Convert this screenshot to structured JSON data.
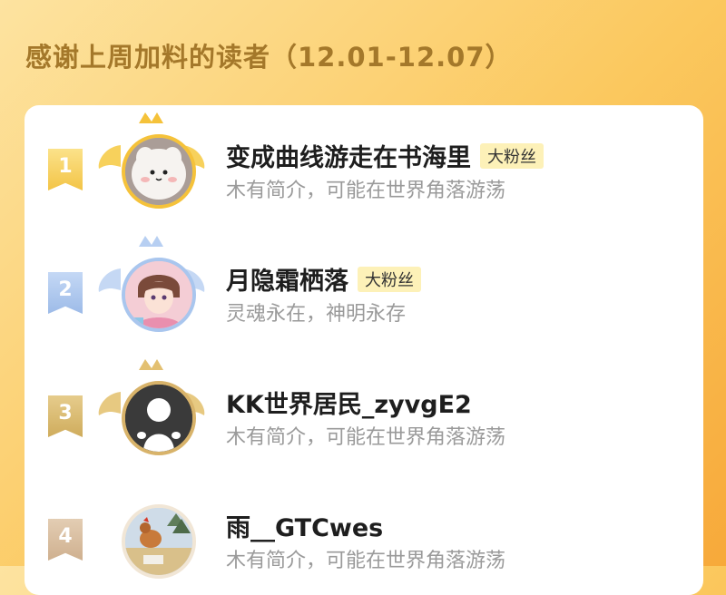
{
  "page": {
    "title": "感谢上周加料的读者（12.01-12.07）"
  },
  "readers": [
    {
      "rank": "1",
      "name": "变成曲线游走在书海里",
      "tag": "大粉丝",
      "bio": "木有简介，可能在世界角落游荡",
      "avatar": "fluffy-cat-avatar"
    },
    {
      "rank": "2",
      "name": "月隐霜栖落",
      "tag": "大粉丝",
      "bio": "灵魂永在，神明永存",
      "avatar": "anime-boy-avatar"
    },
    {
      "rank": "3",
      "name": "KK世界居民_zyvgE2",
      "tag": "",
      "bio": "木有简介，可能在世界角落游荡",
      "avatar": "default-ghost-avatar"
    },
    {
      "rank": "4",
      "name": "雨__GTCwes",
      "tag": "",
      "bio": "木有简介，可能在世界角落游荡",
      "avatar": "rooster-photo-avatar"
    }
  ],
  "colors": {
    "gold": "#f5c23a",
    "silver": "#a9c6ee",
    "bronze": "#d8b36a",
    "fourth": "#d9c1a6"
  }
}
